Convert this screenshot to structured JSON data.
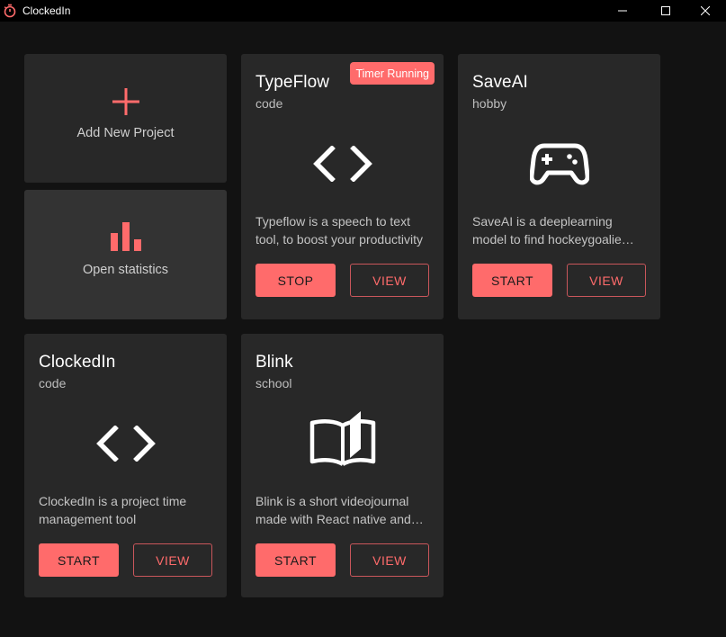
{
  "window": {
    "title": "ClockedIn",
    "accent": "#ff6b6b"
  },
  "actions": {
    "add_label": "Add New Project",
    "stats_label": "Open statistics"
  },
  "projects": [
    {
      "name": "TypeFlow",
      "category": "code",
      "icon": "code-icon",
      "description": "Typeflow is a speech to text tool, to boost your productivity",
      "primary_label": "STOP",
      "view_label": "VIEW",
      "badge": "Timer Running"
    },
    {
      "name": "SaveAI",
      "category": "hobby",
      "icon": "gamepad-icon",
      "description": "SaveAI is a deeplearning model to find hockeygoalie…",
      "primary_label": "START",
      "view_label": "VIEW"
    },
    {
      "name": "ClockedIn",
      "category": "code",
      "icon": "code-icon",
      "description": "ClockedIn is a project time management tool",
      "primary_label": "START",
      "view_label": "VIEW"
    },
    {
      "name": "Blink",
      "category": "school",
      "icon": "open-book-icon",
      "description": "Blink is a short videojournal made with React native and…",
      "primary_label": "START",
      "view_label": "VIEW"
    }
  ]
}
